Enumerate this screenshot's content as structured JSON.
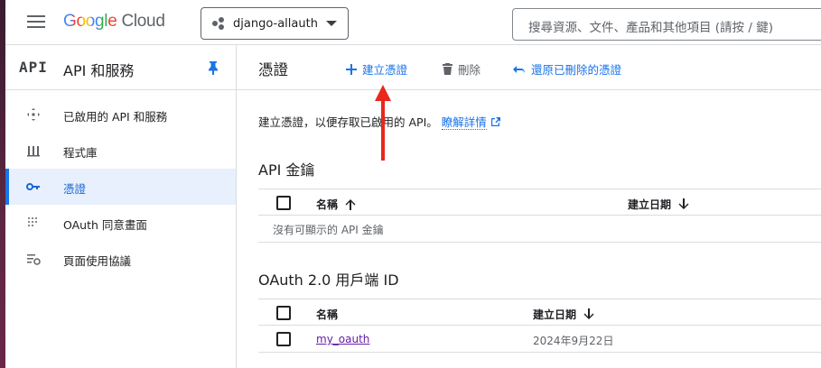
{
  "header": {
    "logo_google": "Google",
    "logo_cloud": "Cloud",
    "project": "django-allauth",
    "search_placeholder": "搜尋資源、文件、產品和其他項目 (請按 / 鍵)"
  },
  "sidebar": {
    "logo_text": "API",
    "title": "API 和服務",
    "items": [
      {
        "label": "已啟用的 API 和服務",
        "icon": "enabled-apis-icon"
      },
      {
        "label": "程式庫",
        "icon": "library-icon"
      },
      {
        "label": "憑證",
        "icon": "key-icon"
      },
      {
        "label": "OAuth 同意畫面",
        "icon": "oauth-consent-icon"
      },
      {
        "label": "頁面使用協議",
        "icon": "page-usage-icon"
      }
    ]
  },
  "main": {
    "title": "憑證",
    "create_label": "建立憑證",
    "delete_label": "刪除",
    "restore_label": "還原已刪除的憑證",
    "description": "建立憑證，以便存取已啟用的 API。",
    "learn_more": "瞭解詳情",
    "api_keys": {
      "title": "API 金鑰",
      "col_name": "名稱",
      "col_date": "建立日期",
      "empty": "沒有可顯示的 API 金鑰"
    },
    "oauth": {
      "title": "OAuth 2.0 用戶端 ID",
      "col_name": "名稱",
      "col_date": "建立日期",
      "rows": [
        {
          "name": "my_oauth",
          "date": "2024年9月22日"
        }
      ]
    }
  },
  "colors": {
    "accent": "#1a73e8",
    "annotation_arrow": "#e8281c",
    "active_bg": "#e8f0fe"
  }
}
